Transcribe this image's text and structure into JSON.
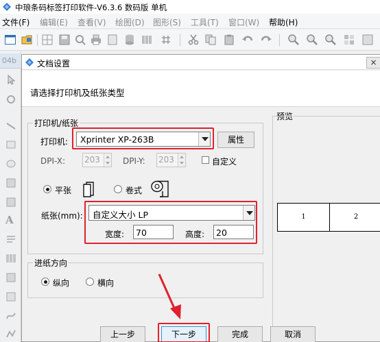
{
  "app": {
    "title": "中琅条码标签打印软件-V6.3.6 数码版 单机"
  },
  "menu": {
    "file": "文件(F)",
    "edit": "编辑(E)",
    "view": "查看(V)",
    "draw": "绘图(D)",
    "shape": "图形(S)",
    "tools": "工具(T)",
    "window": "窗口(W)",
    "help": "帮助(H)"
  },
  "left_tab": {
    "label": "04b"
  },
  "dialog": {
    "title": "文档设置",
    "close_label": "×",
    "prompt": "请选择打印机及纸张类型",
    "printer_group": {
      "legend": "打印机/纸张",
      "printer_label": "打印机:",
      "printer_value": "Xprinter XP-263B",
      "properties_button": "属性",
      "dpi_x_label": "DPI-X:",
      "dpi_x_value": "203",
      "dpi_y_label": "DPI-Y:",
      "dpi_y_value": "203",
      "custom_dpi_label": "自定义",
      "custom_dpi_checked": false,
      "sheet_label": "平张",
      "sheet_selected": true,
      "roll_label": "卷式",
      "roll_selected": false,
      "paper_label": "纸张(mm):",
      "paper_value": "自定义大小 LP",
      "width_label": "宽度:",
      "width_value": "70",
      "height_label": "高度:",
      "height_value": "20"
    },
    "feed_group": {
      "legend": "进纸方向",
      "portrait_label": "纵向",
      "portrait_selected": true,
      "landscape_label": "横向",
      "landscape_selected": false
    },
    "preview": {
      "label": "预览",
      "cells": [
        "1",
        "2"
      ]
    },
    "buttons": {
      "prev": "上一步",
      "next": "下一步",
      "finish": "完成",
      "cancel": "取消"
    }
  },
  "colors": {
    "highlight": "#e0202e",
    "arrow": "#e0202e",
    "app_icon": "#3b7dd8"
  },
  "icons": [
    "app-logo-icon",
    "new-icon",
    "open-icon",
    "save-icon",
    "print-icon",
    "barcode-icon",
    "cut-icon",
    "copy-icon",
    "paste-icon",
    "undo-icon",
    "redo-icon",
    "zoom-icon"
  ]
}
